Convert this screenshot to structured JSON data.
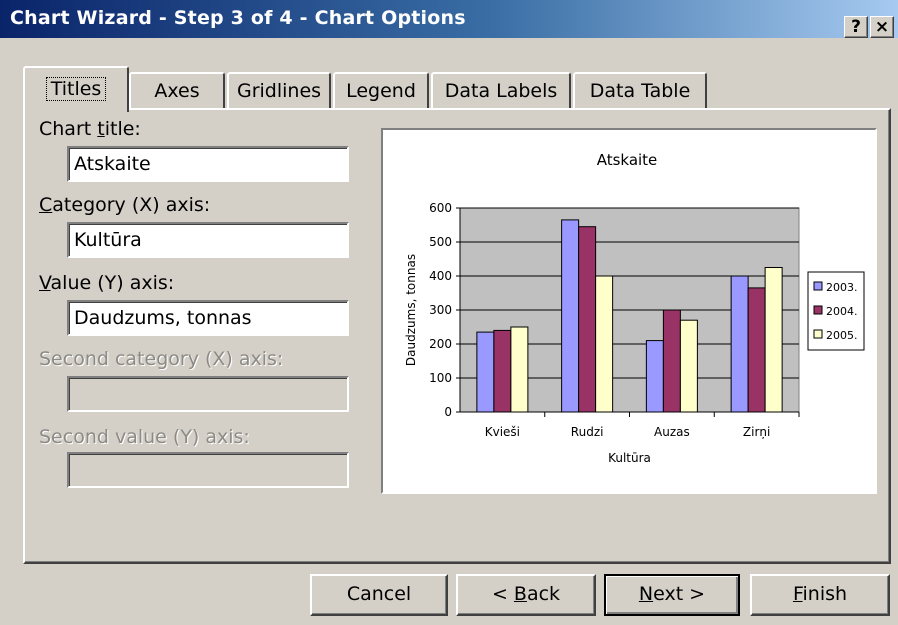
{
  "dialog": {
    "title": "Chart Wizard - Step 3 of 4 - Chart Options",
    "help_glyph": "?",
    "close_glyph": "×"
  },
  "tabs": [
    {
      "label": "Titles",
      "active": true
    },
    {
      "label": "Axes",
      "active": false
    },
    {
      "label": "Gridlines",
      "active": false
    },
    {
      "label": "Legend",
      "active": false
    },
    {
      "label": "Data Labels",
      "active": false
    },
    {
      "label": "Data Table",
      "active": false
    }
  ],
  "form": {
    "chart_title_label": {
      "pre": "Chart ",
      "key": "t",
      "post": "itle:"
    },
    "chart_title_value": "Atskaite",
    "category_x_label": {
      "pre": "",
      "key": "C",
      "post": "ategory (X) axis:"
    },
    "category_x_value": "Kultūra",
    "value_y_label": {
      "pre": "",
      "key": "V",
      "post": "alue (Y) axis:"
    },
    "value_y_value": "Daudzums, tonnas",
    "second_category_label": "Second category (X) axis:",
    "second_category_value": "",
    "second_value_label": "Second value (Y) axis:",
    "second_value_value": ""
  },
  "buttons": {
    "cancel": {
      "pre": "Cancel",
      "key": "",
      "post": ""
    },
    "back": {
      "pre": "< ",
      "key": "B",
      "post": "ack"
    },
    "next": {
      "pre": "",
      "key": "N",
      "post": "ext >"
    },
    "finish": {
      "pre": "",
      "key": "F",
      "post": "inish"
    }
  },
  "colors": {
    "plot_area": "#c0c0c0",
    "series": [
      "#9999ff",
      "#993366",
      "#ffffcc"
    ]
  },
  "chart_data": {
    "type": "bar",
    "title": "Atskaite",
    "xlabel": "Kultūra",
    "ylabel": "Daudzums, tonnas",
    "categories": [
      "Kvieši",
      "Rudzi",
      "Auzas",
      "Zirņi"
    ],
    "series": [
      {
        "name": "2003.",
        "values": [
          235,
          565,
          210,
          400
        ]
      },
      {
        "name": "2004.",
        "values": [
          240,
          545,
          300,
          365
        ]
      },
      {
        "name": "2005.",
        "values": [
          250,
          400,
          270,
          425
        ]
      }
    ],
    "ylim": [
      0,
      600
    ],
    "yticks": [
      0,
      100,
      200,
      300,
      400,
      500,
      600
    ],
    "grid": true,
    "legend_position": "right"
  }
}
